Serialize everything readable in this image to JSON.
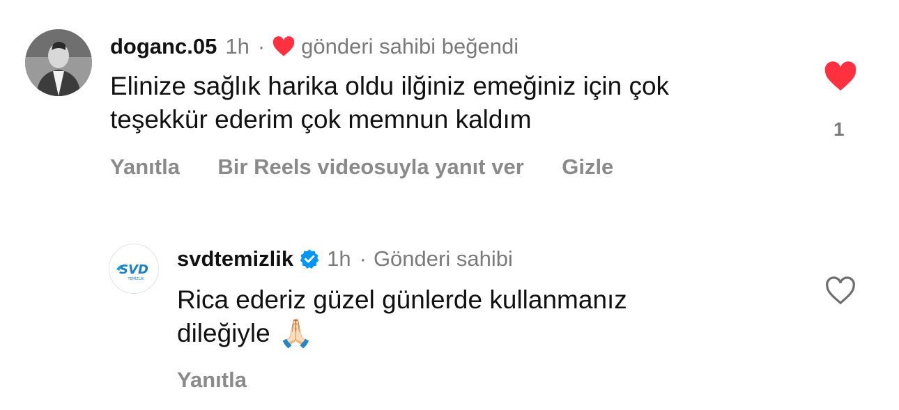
{
  "comments": [
    {
      "username": "doganc.05",
      "time": "1h",
      "separator": "·",
      "owner_liked_text": "gönderi sahibi beğendi",
      "text_line1": "Elinize sağlık harika oldu ilğiniz emeğiniz için çok",
      "text_line2": "teşekkür ederim çok memnun kaldım",
      "like_count": "1",
      "liked": true,
      "actions": {
        "reply": "Yanıtla",
        "reels_reply": "Bir Reels videosuyla yanıt ver",
        "hide": "Gizle"
      }
    },
    {
      "username": "svdtemizlik",
      "verified": true,
      "time": "1h",
      "separator": "·",
      "owner_label": "Gönderi sahibi",
      "text_line1": "Rica ederiz güzel günlerde kullanmanız",
      "text_line2": "dileğiyle",
      "emoji": "🙏🏻",
      "logo_text": "SVD",
      "logo_subtext": "TEMİZLİK",
      "liked": false,
      "actions": {
        "reply": "Yanıtla"
      }
    }
  ],
  "colors": {
    "heart_red": "#ff3040",
    "verified_blue": "#0095f6",
    "brand_blue": "#1aa3d9"
  }
}
